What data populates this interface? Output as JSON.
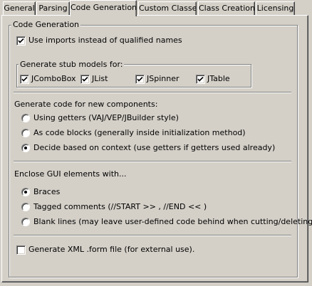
{
  "tabs": [
    {
      "label": "General",
      "active": false
    },
    {
      "label": "Parsing",
      "active": false
    },
    {
      "label": "Code Generation",
      "active": true
    },
    {
      "label": "Custom Classes",
      "active": false
    },
    {
      "label": "Class Creation",
      "active": false
    },
    {
      "label": "Licensing",
      "active": false
    }
  ],
  "code_generation": {
    "group_title": "Code Generation",
    "use_imports": {
      "label": "Use imports instead of qualified names",
      "checked": true
    },
    "stub_models": {
      "title": "Generate stub models for:",
      "items": [
        {
          "label": "JComboBox",
          "checked": true
        },
        {
          "label": "JList",
          "checked": true
        },
        {
          "label": "JSpinner",
          "checked": true
        },
        {
          "label": "JTable",
          "checked": true
        }
      ]
    },
    "new_components": {
      "title": "Generate code for new components:",
      "options": [
        {
          "label": "Using getters (VAJ/VEP/JBuilder style)",
          "selected": false
        },
        {
          "label": "As code blocks (generally inside initialization method)",
          "selected": false
        },
        {
          "label": "Decide based on context (use getters if getters used already)",
          "selected": true
        }
      ]
    },
    "enclose_gui": {
      "title": "Enclose GUI elements with...",
      "options": [
        {
          "label": "Braces",
          "selected": true
        },
        {
          "label": "Tagged comments (//START >> , //END << )",
          "selected": false
        },
        {
          "label": "Blank lines (may leave user-defined code behind when cutting/deleting)",
          "selected": false
        }
      ]
    },
    "xml_form": {
      "label": "Generate XML .form file (for external use).",
      "checked": false
    }
  }
}
